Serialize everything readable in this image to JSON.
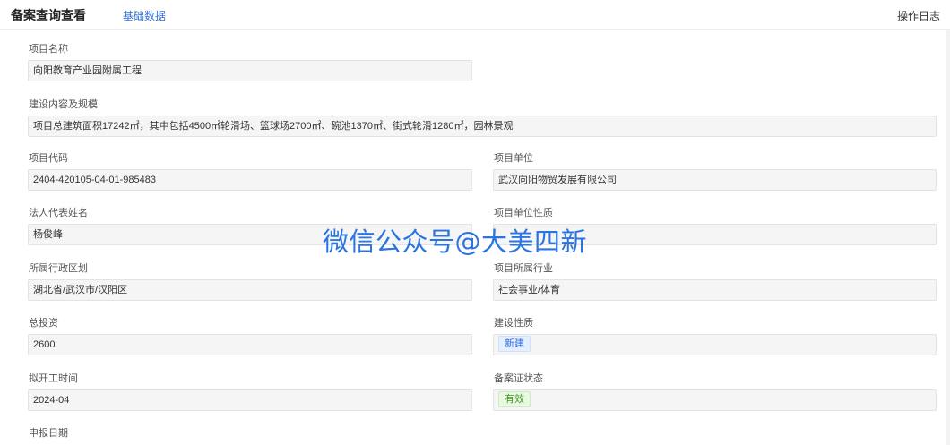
{
  "header": {
    "title": "备案查询查看",
    "tab_basic": "基础数据",
    "op_log": "操作日志"
  },
  "fields": {
    "project_name": {
      "label": "项目名称",
      "value": "向阳教育产业园附属工程"
    },
    "scale": {
      "label": "建设内容及规模",
      "value": "项目总建筑面积17242㎡，其中包括4500㎡轮滑场、篮球场2700㎡、碗池1370㎡、街式轮滑1280㎡，园林景观"
    },
    "project_code": {
      "label": "项目代码",
      "value": "2404-420105-04-01-985483"
    },
    "project_unit": {
      "label": "项目单位",
      "value": "武汉向阳物贸发展有限公司"
    },
    "legal_rep": {
      "label": "法人代表姓名",
      "value": "杨俊峰"
    },
    "unit_nature": {
      "label": "项目单位性质",
      "value": ""
    },
    "region": {
      "label": "所属行政区划",
      "value": "湖北省/武汉市/汉阳区"
    },
    "industry": {
      "label": "项目所属行业",
      "value": "社会事业/体育"
    },
    "investment": {
      "label": "总投资",
      "value": "2600"
    },
    "build_nature": {
      "label": "建设性质",
      "value": "新建"
    },
    "start_time": {
      "label": "拟开工时间",
      "value": "2024-04"
    },
    "record_status": {
      "label": "备案证状态",
      "value": "有效"
    },
    "apply_date": {
      "label": "申报日期"
    }
  },
  "watermark": "微信公众号@大美四新",
  "colors": {
    "accent": "#2f6fd8",
    "status_valid": "#3f9a1e"
  }
}
